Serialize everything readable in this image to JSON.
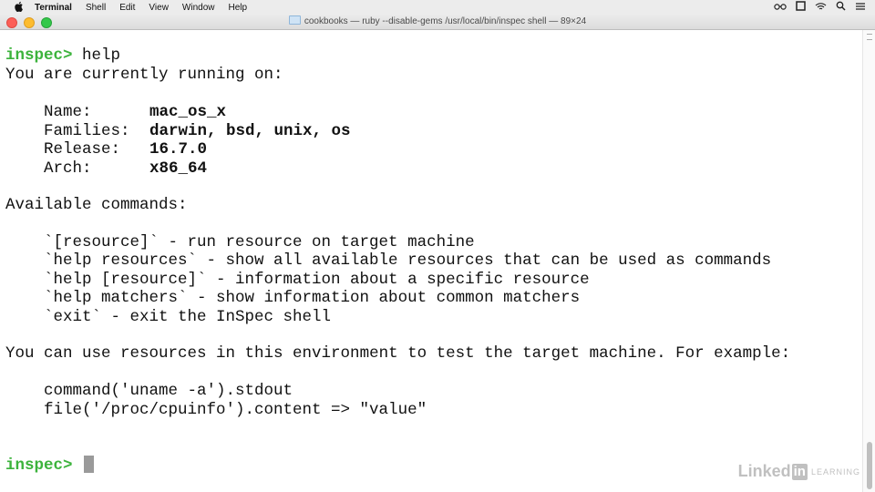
{
  "menubar": {
    "app": "Terminal",
    "items": [
      "Shell",
      "Edit",
      "View",
      "Window",
      "Help"
    ]
  },
  "window": {
    "title": "cookbooks — ruby --disable-gems /usr/local/bin/inspec shell — 89×24"
  },
  "terminal": {
    "prompt": "inspec>",
    "command": "help",
    "intro": "You are currently running on:",
    "platform": [
      {
        "label": "Name:",
        "value": "mac_os_x"
      },
      {
        "label": "Families:",
        "value": "darwin, bsd, unix, os"
      },
      {
        "label": "Release:",
        "value": "16.7.0"
      },
      {
        "label": "Arch:",
        "value": "x86_64"
      }
    ],
    "commands_heading": "Available commands:",
    "commands": [
      "`[resource]` - run resource on target machine",
      "`help resources` - show all available resources that can be used as commands",
      "`help [resource]` - information about a specific resource",
      "`help matchers` - show information about common matchers",
      "`exit` - exit the InSpec shell"
    ],
    "usage": "You can use resources in this environment to test the target machine. For example:",
    "examples": [
      "command('uname -a').stdout",
      "file('/proc/cpuinfo').content => \"value\""
    ]
  },
  "watermark": {
    "linked": "Linked",
    "in": "in",
    "learning": "LEARNING"
  },
  "colors": {
    "prompt": "#3cb33c",
    "close": "#fc5f57",
    "minimize": "#fdbc2e",
    "zoom": "#34c84a"
  }
}
